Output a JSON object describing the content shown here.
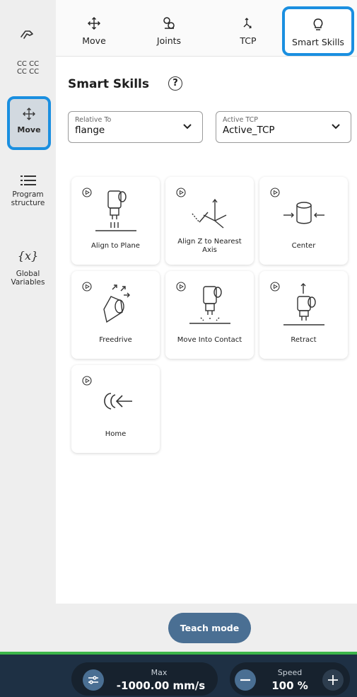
{
  "robot": {
    "name_line1": "CC CC",
    "name_line2": "CC CC"
  },
  "sidebar": {
    "items": [
      {
        "label": "Move",
        "icon": "move-arrows-icon",
        "active": true
      },
      {
        "label": "Program structure",
        "label_line1": "Program",
        "label_line2": "structure",
        "icon": "list-icon"
      },
      {
        "label": "Global Variables",
        "label_line1": "Global",
        "label_line2": "Variables",
        "icon": "variables-icon",
        "icon_text": "{x}"
      }
    ]
  },
  "tabs": [
    {
      "label": "Move",
      "icon": "move-arrows-icon"
    },
    {
      "label": "Joints",
      "icon": "joints-icon"
    },
    {
      "label": "TCP",
      "icon": "tcp-icon"
    },
    {
      "label": "Smart Skills",
      "icon": "lightbulb-icon",
      "active": true
    }
  ],
  "main": {
    "title": "Smart Skills",
    "help_glyph": "?",
    "relative_to": {
      "label": "Relative To",
      "value": "flange"
    },
    "active_tcp": {
      "label": "Active TCP",
      "value": "Active_TCP"
    },
    "skills": [
      {
        "label": "Align to Plane",
        "icon": "align-to-plane-icon"
      },
      {
        "label": "Align Z to Nearest Axis",
        "label_line1": "Align Z to Nearest",
        "label_line2": "Axis",
        "icon": "align-z-axis-icon"
      },
      {
        "label": "Center",
        "icon": "center-icon"
      },
      {
        "label": "Freedrive",
        "icon": "freedrive-icon"
      },
      {
        "label": "Move Into Contact",
        "icon": "move-into-contact-icon"
      },
      {
        "label": "Retract",
        "icon": "retract-icon"
      },
      {
        "label": "Home",
        "icon": "home-icon"
      }
    ],
    "teach_mode_label": "Teach mode"
  },
  "footer": {
    "max_label": "Max",
    "max_value": "-1000.00 mm/s",
    "speed_label": "Speed",
    "speed_value": "100 %"
  },
  "colors": {
    "accent_highlight": "#1a8fe0",
    "button_blue": "#4a6f93",
    "footer_bg": "#1e3044",
    "status_green": "#3cb54a"
  }
}
